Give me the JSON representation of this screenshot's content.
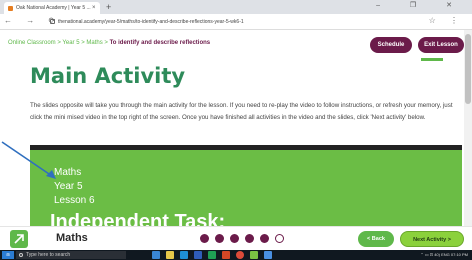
{
  "browser": {
    "tab_title": "Oak National Academy | Year 5 ...",
    "tab_close": "×",
    "new_tab": "+",
    "window_controls": "–  ❐  ✕",
    "nav_icons": "←  →  ⟳",
    "url": "thenational.academy/year-5/maths/to-identify-and-describe-reflections-year-5-wk6-1",
    "addr_right_icons": "☆  ⋮"
  },
  "breadcrumb": {
    "prefix": "Online Classroom > Year 5 > Maths > ",
    "current": "To identify and describe reflections"
  },
  "header_buttons": {
    "schedule": "Schedule",
    "exit": "Exit Lesson"
  },
  "main": {
    "title": "Main Activity",
    "description": "The slides opposite will take you through the main activity for the lesson. If you need to re-play the video to follow instructions, or refresh your memory, just click the mini mised video in the top right of the screen. Once you have finished all activities in the video and the slides, click 'Next activity' below."
  },
  "slide": {
    "line1": "Maths",
    "line2": "Year 5",
    "line3": "Lesson 6",
    "task": "Independent Task:"
  },
  "lessonbar": {
    "subject": "Maths",
    "back": "< Back",
    "next": "Next Activity >",
    "progress": {
      "filled": 5,
      "total": 6
    }
  },
  "taskbar": {
    "start": "⊞",
    "search_placeholder": "Type here to search",
    "tray": "⌃ ▭ ⊡ 40)  ENG  07:10 PM"
  },
  "colors": {
    "brand_plum": "#6b1b4a",
    "brand_green": "#5fb84a",
    "slide_green": "#6bbd45",
    "title_green": "#2e8b5a"
  }
}
